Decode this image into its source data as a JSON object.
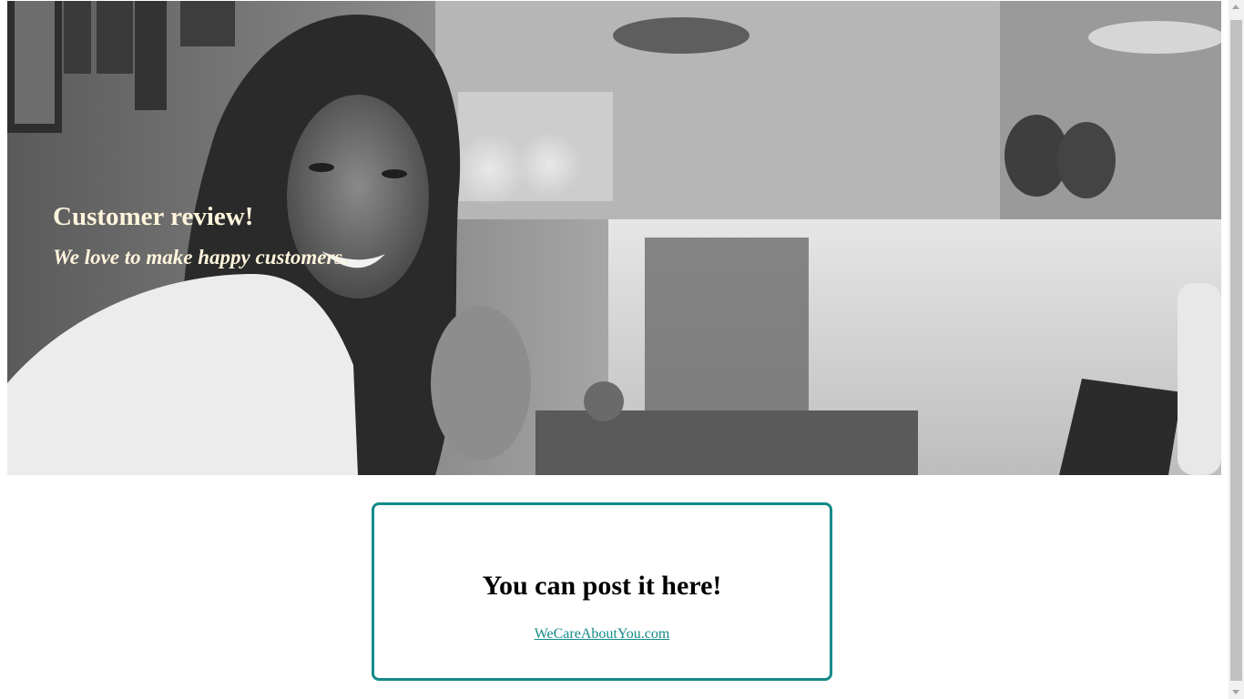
{
  "hero": {
    "title": "Customer review!",
    "subtitle": "We love to make happy customers.",
    "text_color": "#fff4dc",
    "image": "smiling-customer-in-cafe-photo"
  },
  "card": {
    "heading": "You can post it here!",
    "link_text": "WeCareAboutYou.com",
    "accent_color": "#138a88"
  },
  "scrollbar": {
    "up_icon": "chevron-up-icon",
    "down_icon": "chevron-down-icon"
  }
}
